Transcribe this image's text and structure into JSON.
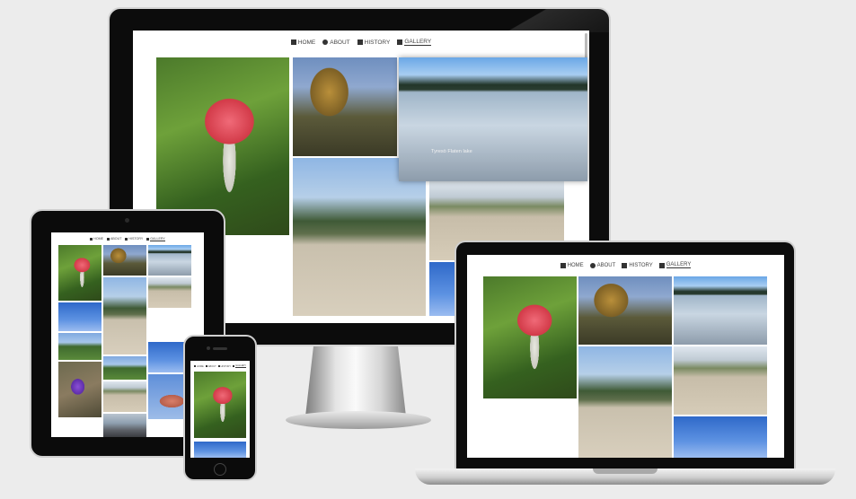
{
  "nav": {
    "items": [
      {
        "label": "HOME",
        "icon": "home-icon"
      },
      {
        "label": "ABOUT",
        "icon": "info-icon"
      },
      {
        "label": "HISTORY",
        "icon": "book-icon"
      },
      {
        "label": "GALLERY",
        "icon": "images-icon"
      }
    ],
    "active": "GALLERY"
  },
  "gallery": {
    "caption": "Tyresö Flaten lake"
  },
  "colors": {
    "background": "#ececec",
    "device_frame": "#0c0c0c",
    "screen": "#ffffff"
  }
}
